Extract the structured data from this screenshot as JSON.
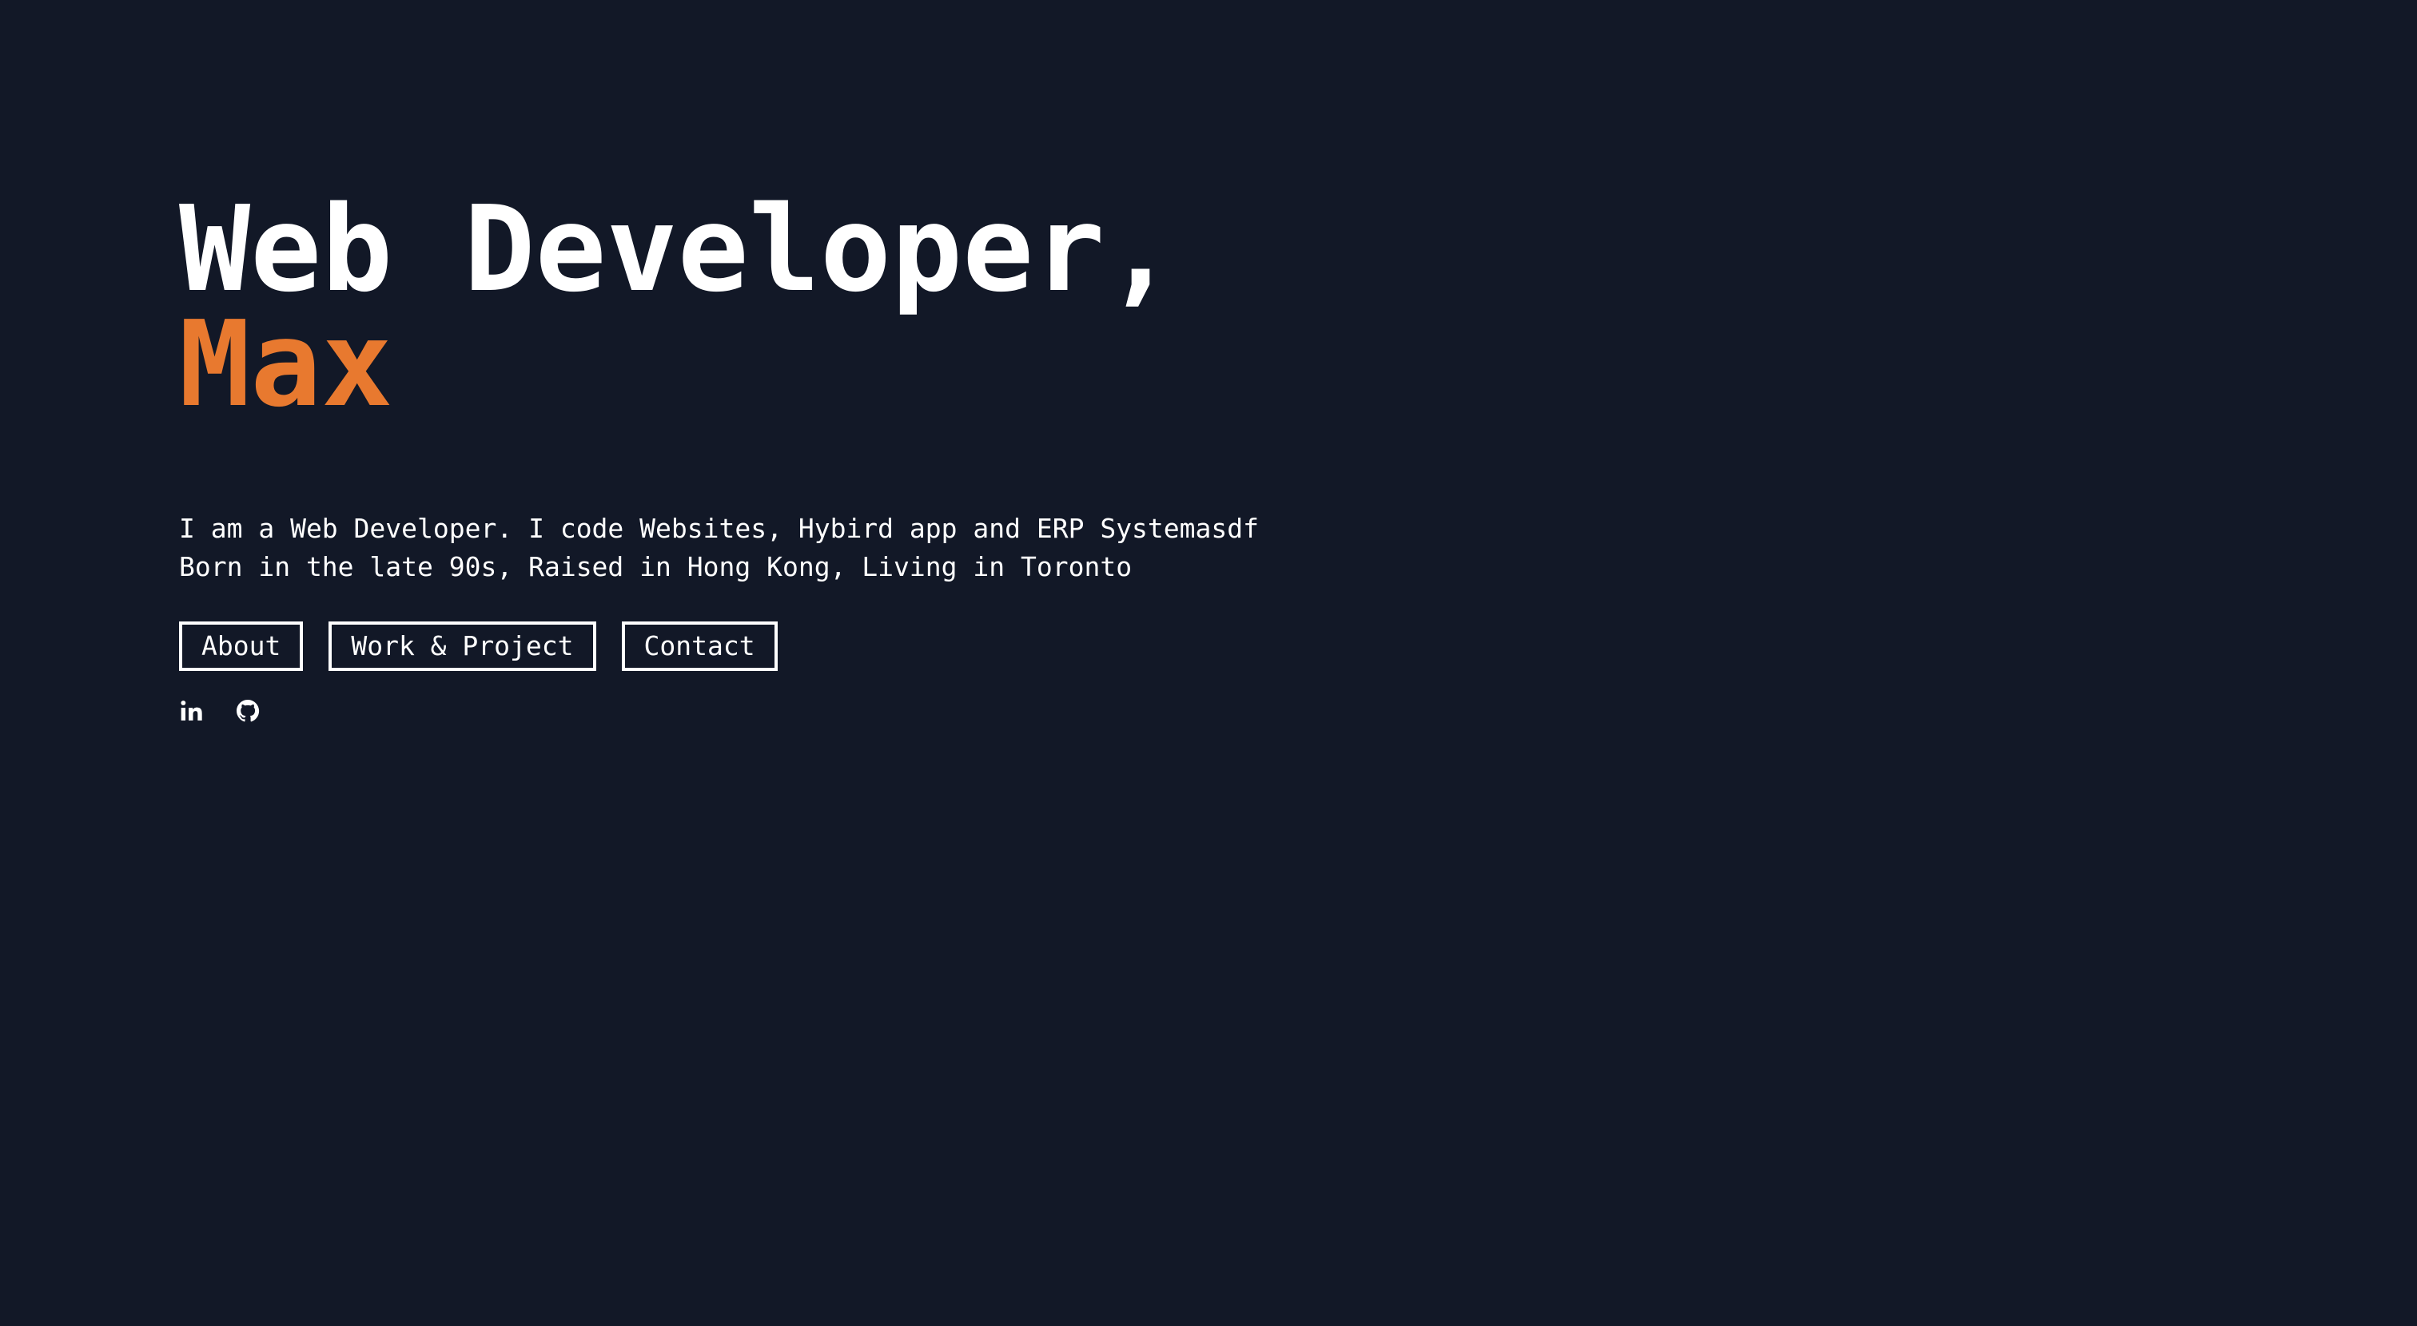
{
  "hero": {
    "headline_line1": "Web Developer,",
    "headline_line2": "Max",
    "intro_line1": "I am a Web Developer. I code Websites, Hybird app and ERP Systemasdf",
    "intro_line2": "Born in the late 90s, Raised in Hong Kong, Living in Toronto"
  },
  "nav": {
    "about_label": "About",
    "work_label": "Work & Project",
    "contact_label": "Contact"
  },
  "social": {
    "icons": [
      "linkedin-icon",
      "github-icon"
    ]
  },
  "colors": {
    "background": "#121827",
    "text": "#ffffff",
    "accent": "#e8792f"
  }
}
